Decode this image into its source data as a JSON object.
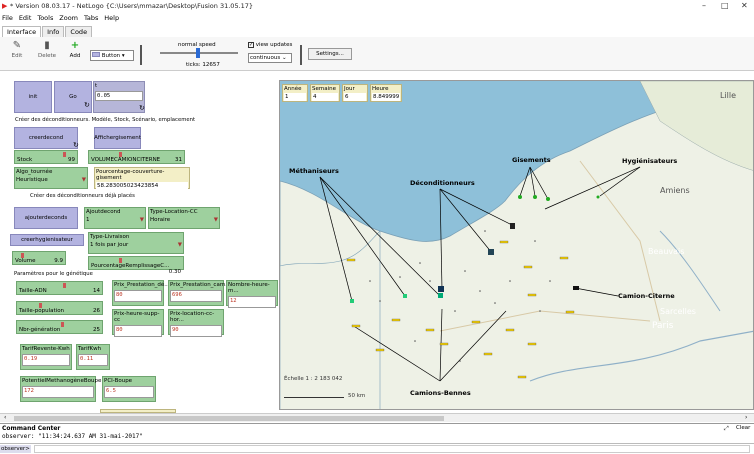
{
  "window": {
    "title": "* Version 08.03.17 - NetLogo {C:\\Users\\mmazar\\Desktop\\Fusion 31.05.17}",
    "controls": [
      "–",
      "□",
      "✕"
    ]
  },
  "menu": [
    "File",
    "Edit",
    "Tools",
    "Zoom",
    "Tabs",
    "Help"
  ],
  "tabs": [
    "Interface",
    "Info",
    "Code"
  ],
  "toolbar": {
    "edit": "Edit",
    "delete": "Delete",
    "add": "Add",
    "widget_type": "Button",
    "speed_label": "normal speed",
    "ticks": "ticks: 12657",
    "view_updates": "view updates",
    "update_mode": "continuous",
    "settings": "Settings..."
  },
  "widgets": {
    "init": "init",
    "go": "Go",
    "t_label": "t",
    "t_value": "0.05",
    "note1": "Créer des déconditionneurs. Modèle, Stock, Scénario, emplacement",
    "creerdecond": "creerdecond",
    "affichergisement": "Affichergisement",
    "stock_label": "Stock",
    "stock_value": "99",
    "volume_cc_label": "VOLUMECAMIONCITERNE",
    "volume_cc_value": "31",
    "algo_label": "Algo_tournée",
    "algo_value": "Heuristique",
    "pourcentage_label": "Pourcentage-couverture-gisement",
    "pourcentage_value": "58.283005023423854",
    "note2": "Créer des déconditionneurs déjà placés",
    "ajouterdeconds": "ajouterdeconds",
    "ajoutdecond_label": "Ajoutdecond",
    "ajoutdecond_value": "1",
    "typelocation_label": "Type-Location-CC",
    "typelocation_value": "Horaire",
    "creerhygienisateur": "creerhygienisateur",
    "typelivraison_label": "Type-Livraison",
    "typelivraison_value": "1 fois par jour",
    "volume_label": "Volume",
    "volume_value": "9.9",
    "remplissage_label": "PourcentageRemplissageC...",
    "remplissage_value": "0.30",
    "note3": "Paramètres pour le génétique",
    "taille_adn_label": "Taille-ADN",
    "taille_adn_value": "14",
    "taille_pop_label": "Taille-population",
    "taille_pop_value": "26",
    "nbr_gen_label": "Nbr-génération",
    "nbr_gen_value": "25",
    "prix_presta_dk_label": "Prix_Prestation_dé...",
    "prix_presta_dk_value": "80",
    "prix_presta_cam_label": "Prix_Prestation_cam...",
    "prix_presta_cam_value": "696",
    "nombre_heure_label": "Nombre-heure-m...",
    "nombre_heure_value": "12",
    "prix_heure_label": "Prix-heure-supp-cc",
    "prix_heure_value": "80",
    "prix_location_label": "Prix-location-cc-hor...",
    "prix_location_value": "90",
    "tarif_revente_label": "TarifRevente-Kwh",
    "tarif_revente_value": "0.19",
    "tarif_kwh_label": "TarifKwh",
    "tarif_kwh_value": "0.11",
    "potentiel_label": "PotentielMethanogèneBoupe",
    "potentiel_value": "172",
    "pci_label": "PCI-Boupe",
    "pci_value": "6.5"
  },
  "monitors": [
    {
      "label": "Année",
      "value": "1"
    },
    {
      "label": "Semaine",
      "value": "4"
    },
    {
      "label": "Jour",
      "value": "6"
    },
    {
      "label": "Heure",
      "value": "8.849999"
    }
  ],
  "map": {
    "labels": {
      "methaniseurs": "Méthaniseurs",
      "gisements": "Gisements",
      "hygienisateurs": "Hygiénisateurs",
      "deconditionneurs": "Déconditionneurs",
      "camion_citerne": "Camion-Citerne",
      "camions_bennes": "Camions-Bennes"
    },
    "places": {
      "lille": "Lille",
      "amiens": "Amiens",
      "beauvais": "Beauvais",
      "sarcelles": "Sarcelles",
      "paris": "Paris"
    },
    "scale": "Échelle 1 : 2 183 042",
    "scale_bar": "50 km"
  },
  "command_center": {
    "title": "Command Center",
    "clear": "Clear",
    "output": "observer: \"11:34:24.637 AM 31-mai-2017\"",
    "prompt": "observer>"
  }
}
